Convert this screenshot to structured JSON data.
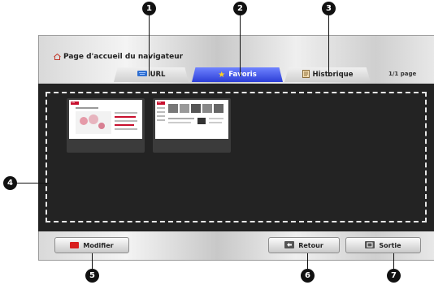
{
  "header": {
    "title": "Page d'accueil du navigateur",
    "page_indicator": "1/1 page"
  },
  "tabs": [
    {
      "label": "URL",
      "icon": "keyboard-icon"
    },
    {
      "label": "Favoris",
      "icon": "star-icon"
    },
    {
      "label": "Historique",
      "icon": "history-icon"
    }
  ],
  "buttons": {
    "modifier": {
      "label": "Modifier",
      "key_color": "#d81f1f"
    },
    "retour": {
      "label": "Retour"
    },
    "sortie": {
      "label": "Sortie"
    }
  },
  "colors": {
    "active_tab": "#3446e0",
    "content_bg": "#232323"
  },
  "thumbnails": [
    {
      "brand": "LG"
    },
    {
      "brand": "LG"
    }
  ],
  "callouts": [
    "1",
    "2",
    "3",
    "4",
    "5",
    "6",
    "7"
  ]
}
